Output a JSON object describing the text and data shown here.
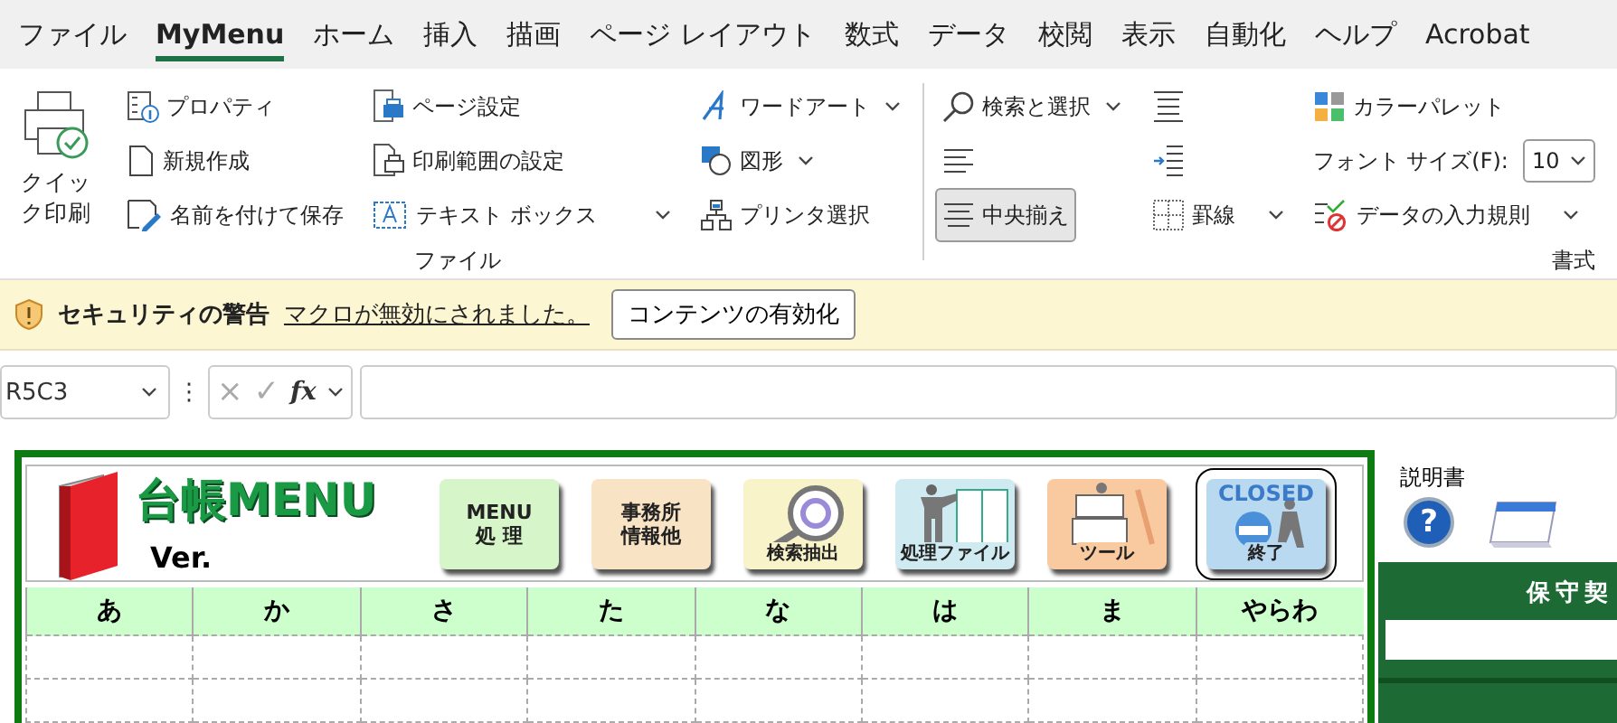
{
  "ribbon_tabs": [
    {
      "label": "ファイル",
      "selected": false
    },
    {
      "label": "MyMenu",
      "selected": true
    },
    {
      "label": "ホーム",
      "selected": false
    },
    {
      "label": "挿入",
      "selected": false
    },
    {
      "label": "描画",
      "selected": false
    },
    {
      "label": "ページ レイアウト",
      "selected": false
    },
    {
      "label": "数式",
      "selected": false
    },
    {
      "label": "データ",
      "selected": false
    },
    {
      "label": "校閲",
      "selected": false
    },
    {
      "label": "表示",
      "selected": false
    },
    {
      "label": "自動化",
      "selected": false
    },
    {
      "label": "ヘルプ",
      "selected": false
    },
    {
      "label": "Acrobat",
      "selected": false
    }
  ],
  "file_group": {
    "label": "ファイル",
    "quick_print": "クイック印刷",
    "columns": [
      [
        {
          "label": "プロパティ",
          "kind": "button"
        },
        {
          "label": "新規作成",
          "kind": "button"
        },
        {
          "label": "名前を付けて保存",
          "kind": "button"
        }
      ],
      [
        {
          "label": "ページ設定",
          "kind": "button"
        },
        {
          "label": "印刷範囲の設定",
          "kind": "button"
        },
        {
          "label": "テキスト ボックス",
          "kind": "dropdown"
        }
      ],
      [
        {
          "label": "ワードアート",
          "kind": "dropdown"
        },
        {
          "label": "図形",
          "kind": "dropdown"
        },
        {
          "label": "プリンタ選択",
          "kind": "button"
        }
      ]
    ]
  },
  "format_group": {
    "label": "書式",
    "columns": [
      [
        {
          "label": "検索と選択",
          "kind": "dropdown",
          "pressed": false
        },
        {
          "kind": "icon",
          "pressed": false
        },
        {
          "label": "中央揃え",
          "kind": "button",
          "pressed": true
        }
      ],
      [
        {
          "kind": "icon",
          "pressed": false
        },
        {
          "kind": "icon",
          "pressed": false
        },
        {
          "label": "罫線",
          "kind": "dropdown",
          "pressed": false
        }
      ],
      [
        {
          "label": "カラーパレット",
          "kind": "button",
          "pressed": false
        },
        {
          "label": "フォント サイズ(F):",
          "kind": "field",
          "value": "10"
        },
        {
          "label": "データの入力規則",
          "kind": "dropdown",
          "pressed": false
        }
      ]
    ]
  },
  "security_bar": {
    "title": "セキュリティの警告",
    "message": "マクロが無効にされました。",
    "button": "コンテンツの有効化"
  },
  "formula_bar": {
    "name_box": "R5C3",
    "separator": "⋮",
    "cancel": "×",
    "enter": "✓",
    "function": "fx"
  },
  "sheet": {
    "title": "台帳MENU",
    "version": "Ver.",
    "menu_buttons": [
      {
        "lines": [
          "MENU",
          "処 理"
        ],
        "kind": "text",
        "color": "#d6f5c8"
      },
      {
        "lines": [
          "事務所",
          "情報他"
        ],
        "kind": "text",
        "color": "#f8e3c4"
      },
      {
        "label": "検索抽出",
        "kind": "search",
        "color": "#f8f3c8"
      },
      {
        "label": "処理ファイル",
        "kind": "file",
        "color": "#cfeaf0"
      },
      {
        "label": "ツール",
        "kind": "tool",
        "color": "#f9c9a0"
      },
      {
        "label": "終了",
        "caption": "CLOSED",
        "kind": "close",
        "color": "#b9d9f0"
      }
    ],
    "index_headers": [
      "あ",
      "か",
      "さ",
      "た",
      "な",
      "は",
      "ま",
      "やらわ"
    ],
    "manual_label": "説明書",
    "help_symbol": "?",
    "contract_title": "保守契"
  }
}
